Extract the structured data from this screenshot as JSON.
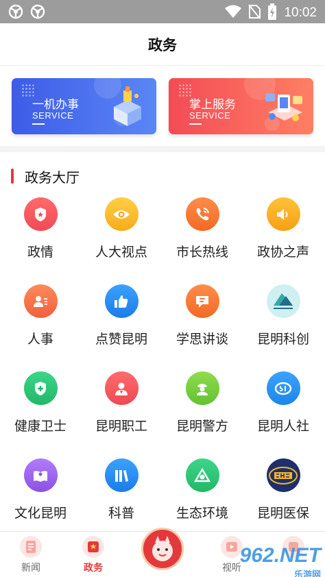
{
  "status_bar": {
    "time": "10:02"
  },
  "header": {
    "title": "政务"
  },
  "banners": [
    {
      "title": "一机办事",
      "subtitle": "SERVICE"
    },
    {
      "title": "掌上服务",
      "subtitle": "SERVICE"
    }
  ],
  "section": {
    "title": "政务大厅"
  },
  "grid": [
    {
      "label": "政情",
      "icon": "police-badge-icon",
      "color": "#f4505c"
    },
    {
      "label": "人大视点",
      "icon": "eye-icon",
      "color": "#f7b82b"
    },
    {
      "label": "市长热线",
      "icon": "phone-icon",
      "color": "#f7742b"
    },
    {
      "label": "政协之声",
      "icon": "speaker-icon",
      "color": "#f7a91e"
    },
    {
      "label": "人事",
      "icon": "person-card-icon",
      "color": "#f5734e"
    },
    {
      "label": "点赞昆明",
      "icon": "thumbs-up-icon",
      "color": "#2d8cf0"
    },
    {
      "label": "学思讲谈",
      "icon": "chat-bubble-icon",
      "color": "#f7742b"
    },
    {
      "label": "昆明科创",
      "icon": "kunming-science-logo",
      "color": "#cfeff0"
    },
    {
      "label": "健康卫士",
      "icon": "health-shield-icon",
      "color": "#2fc77a"
    },
    {
      "label": "昆明职工",
      "icon": "worker-icon",
      "color": "#f4505c"
    },
    {
      "label": "昆明警方",
      "icon": "police-officer-icon",
      "color": "#7ccf3c"
    },
    {
      "label": "昆明人社",
      "icon": "social-security-icon",
      "color": "#2d9cf0"
    },
    {
      "label": "文化昆明",
      "icon": "book-icon",
      "color": "#9b5de5"
    },
    {
      "label": "科普",
      "icon": "books-shelf-icon",
      "color": "#2d8cf0"
    },
    {
      "label": "生态环境",
      "icon": "eco-triangle-icon",
      "color": "#2fc77a"
    },
    {
      "label": "昆明医保",
      "icon": "chs-logo",
      "color": "#1e2f6b"
    }
  ],
  "bottom_nav": [
    {
      "label": "新闻",
      "icon": "news-icon"
    },
    {
      "label": "政务",
      "icon": "government-icon",
      "active": true
    },
    {
      "label": "",
      "icon": "mascot-icon"
    },
    {
      "label": "视听",
      "icon": "video-icon"
    },
    {
      "label": "",
      "icon": "service-icon"
    }
  ],
  "watermark": {
    "text": "962.NET",
    "sub": "乐游网"
  },
  "colors": {
    "accent": "#e4393c",
    "status_bar": "#9c9c9c"
  }
}
